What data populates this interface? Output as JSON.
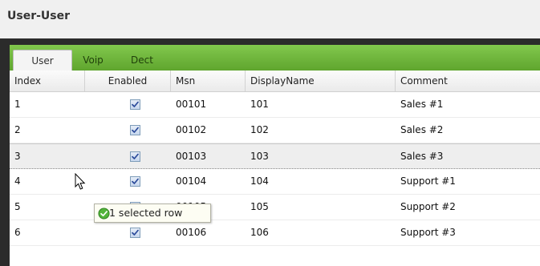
{
  "window": {
    "title": "User-User"
  },
  "tabs": [
    {
      "label": "User",
      "active": true
    },
    {
      "label": "Voip",
      "active": false
    },
    {
      "label": "Dect",
      "active": false
    }
  ],
  "grid": {
    "columns": [
      "Index",
      "Enabled",
      "Msn",
      "DisplayName",
      "Comment"
    ],
    "rows": [
      {
        "index": "1",
        "enabled": true,
        "msn": "00101",
        "display_name": "101",
        "comment": "Sales #1"
      },
      {
        "index": "2",
        "enabled": true,
        "msn": "00102",
        "display_name": "102",
        "comment": "Sales #2"
      },
      {
        "index": "3",
        "enabled": true,
        "msn": "00103",
        "display_name": "103",
        "comment": "Sales #3",
        "selected": true
      },
      {
        "index": "4",
        "enabled": true,
        "msn": "00104",
        "display_name": "104",
        "comment": "Support #1"
      },
      {
        "index": "5",
        "enabled": true,
        "msn": "00105",
        "display_name": "105",
        "comment": "Support #2"
      },
      {
        "index": "6",
        "enabled": true,
        "msn": "00106",
        "display_name": "106",
        "comment": "Support #3"
      }
    ]
  },
  "tooltip": {
    "text": "1 selected row"
  },
  "colors": {
    "accent": "#6cb33f",
    "panel": "#2b2b2b"
  },
  "icons": {
    "tooltip": "check-circle-icon",
    "cursor": "mouse-pointer-icon",
    "checkbox": "checkbox-checked-icon"
  }
}
